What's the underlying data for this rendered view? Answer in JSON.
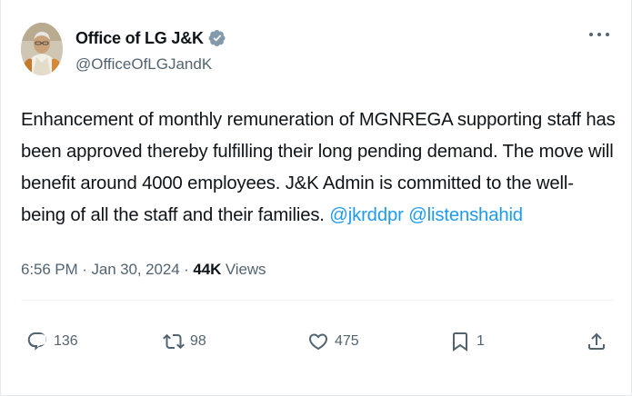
{
  "author": {
    "display_name": "Office of LG J&K",
    "handle": "@OfficeOfLGJandK",
    "verified_icon": "verified-badge-icon",
    "verified_color": "#829aab"
  },
  "tweet": {
    "text": "Enhancement of monthly remuneration of MGNREGA supporting staff has been approved thereby fulfilling their long pending demand. The move will benefit around 4000 employees. J&K Admin is committed to the well-being of all the staff and their families. ",
    "mentions": [
      "@jkrddpr",
      "@listenshahid"
    ],
    "mention_color": "#1d9bf0"
  },
  "meta": {
    "time": "6:56 PM",
    "separator": " · ",
    "date": "Jan 30, 2024",
    "views_count": "44K",
    "views_label": " Views"
  },
  "actions": {
    "replies": "136",
    "reposts": "98",
    "likes": "475",
    "bookmarks": "1"
  },
  "icons": {
    "more": "more-horizontal-icon",
    "reply": "reply-icon",
    "repost": "repost-icon",
    "like": "heart-icon",
    "bookmark": "bookmark-icon",
    "share": "share-icon"
  }
}
